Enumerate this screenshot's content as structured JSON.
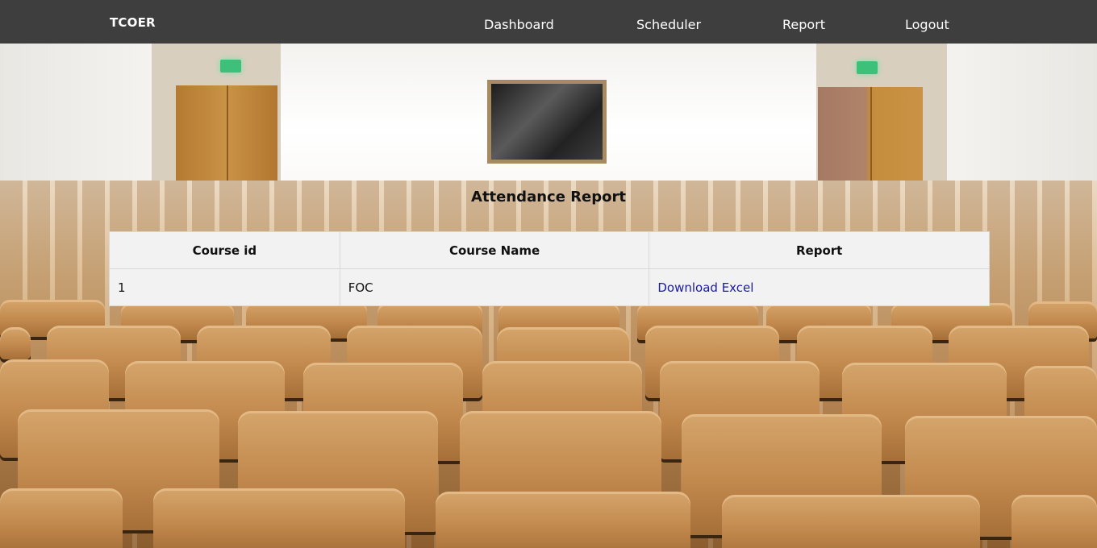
{
  "navbar": {
    "brand": "TCOER",
    "links": [
      "Dashboard",
      "Scheduler",
      "Report",
      "Logout"
    ]
  },
  "page": {
    "title": "Attendance Report"
  },
  "table": {
    "headers": [
      "Course id",
      "Course Name",
      "Report"
    ],
    "rows": [
      {
        "course_id": "1",
        "course_name": "FOC",
        "report_link": "Download Excel"
      }
    ]
  },
  "colors": {
    "navbar_bg": "#3f3e3e",
    "nav_text": "#ffffff",
    "link": "#1a1aa6",
    "table_bg": "#f2f2f2"
  }
}
